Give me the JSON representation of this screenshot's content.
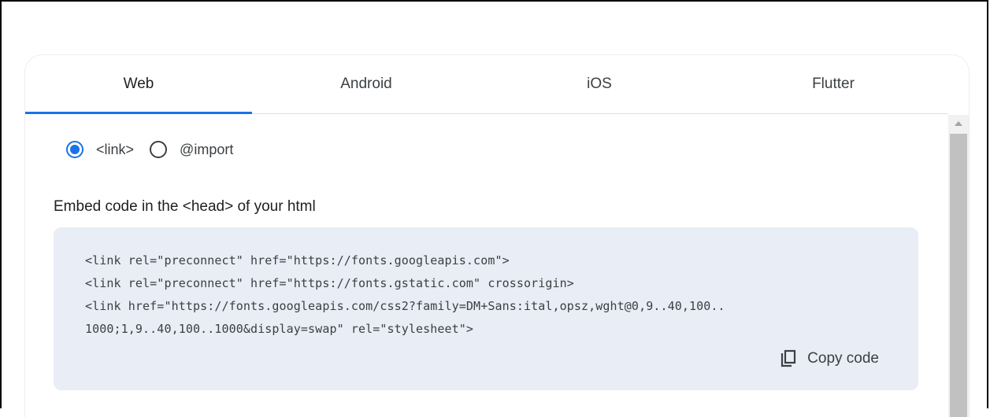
{
  "tabs": [
    {
      "label": "Web",
      "active": true
    },
    {
      "label": "Android",
      "active": false
    },
    {
      "label": "iOS",
      "active": false
    },
    {
      "label": "Flutter",
      "active": false
    }
  ],
  "embed_options": [
    {
      "label": "<link>",
      "selected": true
    },
    {
      "label": "@import",
      "selected": false
    }
  ],
  "embed_title": "Embed code in the <head> of your html",
  "code_lines": [
    "<link rel=\"preconnect\" href=\"https://fonts.googleapis.com\">",
    "<link rel=\"preconnect\" href=\"https://fonts.gstatic.com\" crossorigin>",
    "<link href=\"https://fonts.googleapis.com/css2?family=DM+Sans:ital,opsz,wght@0,9..40,100..",
    "1000;1,9..40,100..1000&display=swap\" rel=\"stylesheet\">"
  ],
  "copy_button": {
    "label": "Copy code",
    "icon": "copy-icon"
  },
  "colors": {
    "accent": "#1a73e8",
    "code_background": "#e8edf6"
  }
}
